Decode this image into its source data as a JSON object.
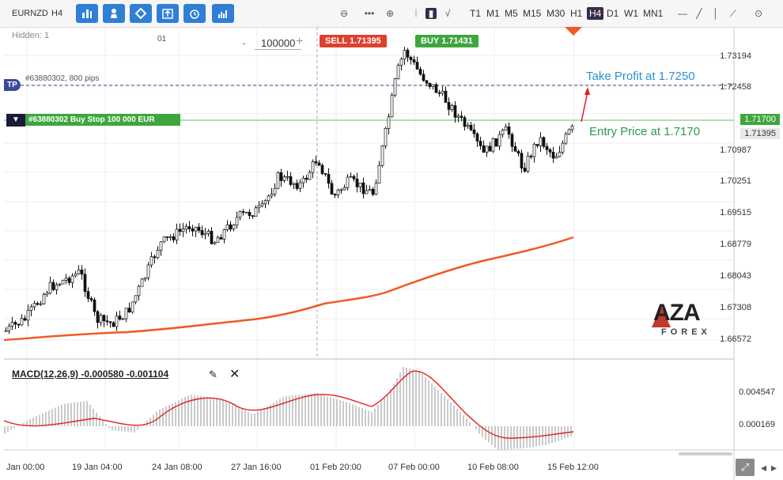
{
  "toolbar": {
    "symbol": "EURNZD",
    "period": "H4",
    "timeframes": [
      "T1",
      "M1",
      "M5",
      "M15",
      "M30",
      "H1",
      "H4",
      "D1",
      "W1",
      "MN1"
    ],
    "active_timeframe": "H4"
  },
  "chart": {
    "hidden_label": "Hidden: 1",
    "sub_label": "01",
    "volume_minus": "-",
    "volume_value": "100000",
    "volume_plus": "+",
    "sell_label": "SELL 1.71395",
    "buy_label": "BUY 1.71431",
    "tp_badge": "TP",
    "tp_order_text": "#63880302, 800 pips",
    "order_text": "#63880302 Buy Stop 100 000 EUR",
    "take_profit_annotation": "Take Profit at 1.7250",
    "entry_price_annotation": "Entry Price at 1.7170",
    "price_axis": [
      "1.73194",
      "1.72458",
      "1.71700",
      "1.71395",
      "1.70987",
      "1.70251",
      "1.69515",
      "1.68779",
      "1.68043",
      "1.67308",
      "1.66572"
    ],
    "macd_label": "MACD(12,26,9) -0.000580 -0.001104",
    "macd_axis": [
      "0.004547",
      "0.000169"
    ],
    "time_axis": [
      "Jan 00:00",
      "19 Jan 04:00",
      "24 Jan 08:00",
      "27 Jan 16:00",
      "01 Feb 20:00",
      "07 Feb 00:00",
      "10 Feb 08:00",
      "15 Feb 12:00"
    ],
    "logo_text": "AZA",
    "logo_sub": "FOREX",
    "colors": {
      "sell": "#e0402e",
      "buy": "#3ea63e",
      "tp_line": "#3a4a9a",
      "entry_line": "#6ab46a",
      "ma": "#f05a24",
      "annotation": "#2a8fd4",
      "annotation_green": "#2a9a4a",
      "tb_blue": "#2f7fd4"
    }
  }
}
